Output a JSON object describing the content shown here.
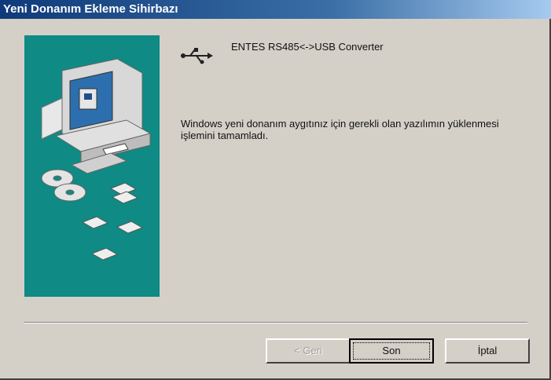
{
  "window": {
    "title": "Yeni Donanım Ekleme Sihirbazı"
  },
  "device": {
    "name": "ENTES RS485<->USB Converter",
    "icon": "usb-icon"
  },
  "message": "Windows yeni donanım aygıtınız için gerekli olan yazılımın yüklenmesi işlemini tamamladı.",
  "buttons": {
    "back": "< Geri",
    "finish": "Son",
    "cancel": "İptal"
  },
  "colors": {
    "panel": "#0f8a84",
    "titlebar": "#0f3a7a",
    "face": "#d4d0c8"
  }
}
